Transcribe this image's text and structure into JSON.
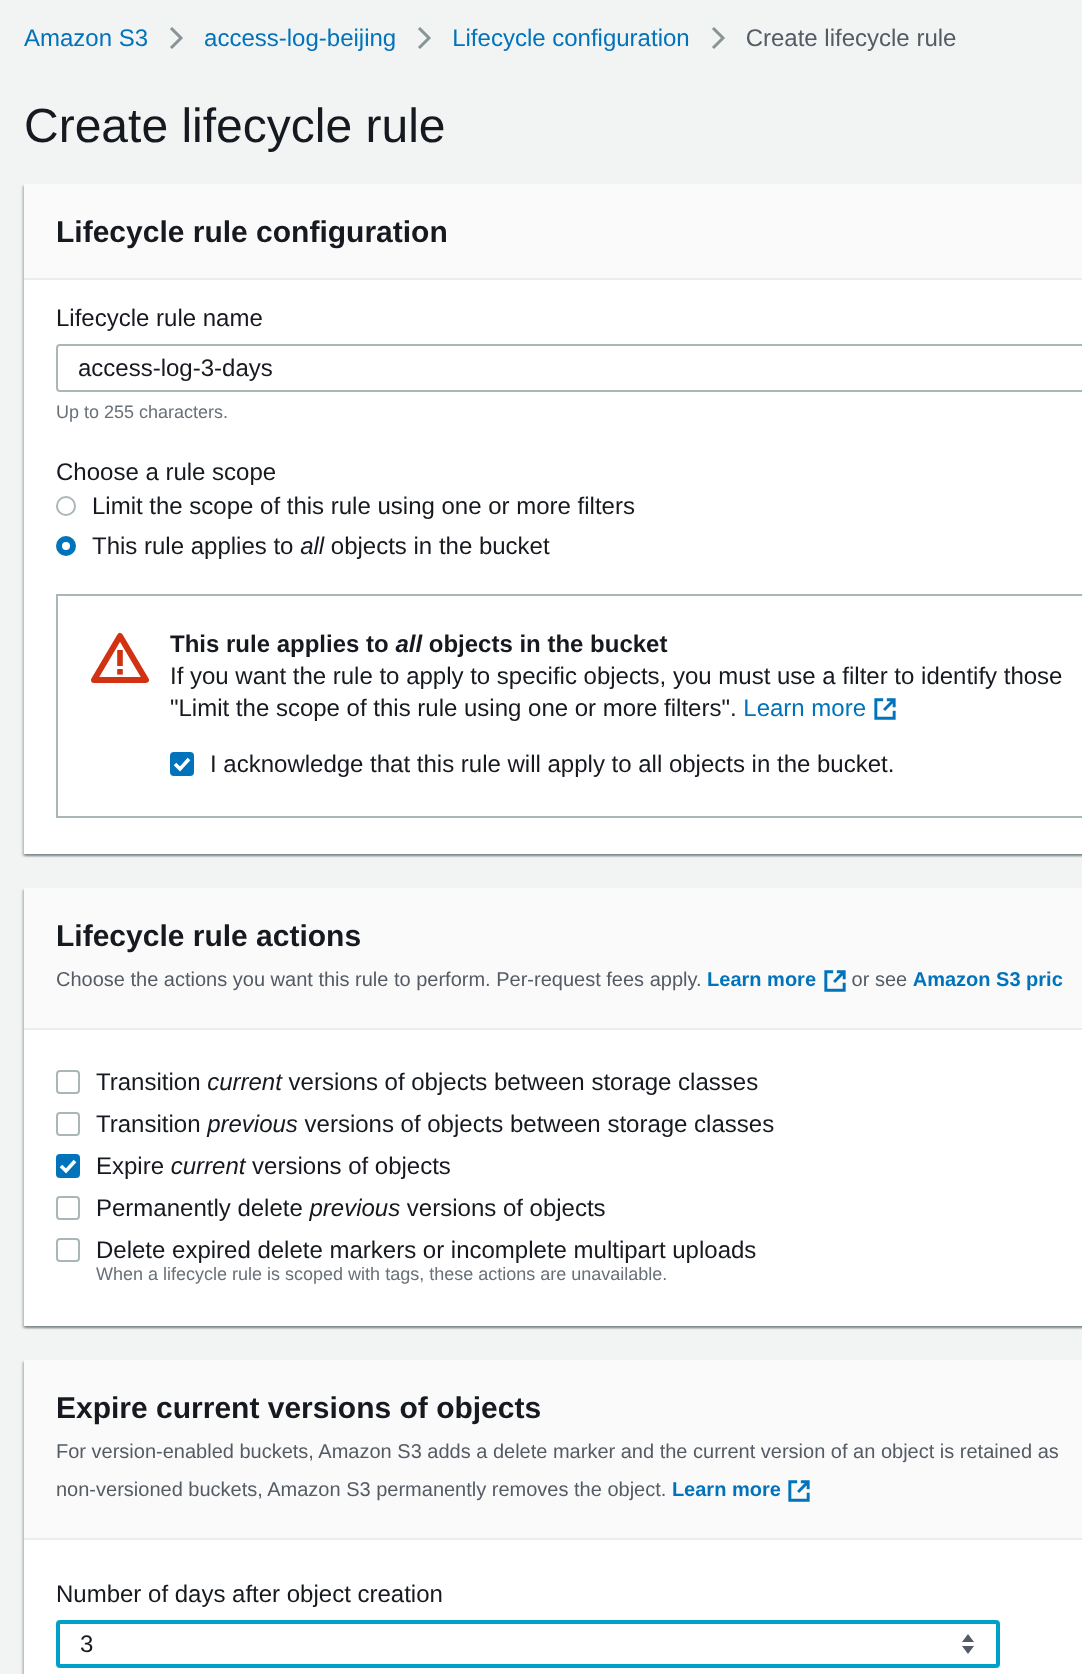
{
  "breadcrumb": [
    {
      "label": "Amazon S3",
      "current": false
    },
    {
      "label": "access-log-beijing",
      "current": false
    },
    {
      "label": "Lifecycle configuration",
      "current": false
    },
    {
      "label": "Create lifecycle rule",
      "current": true
    }
  ],
  "title": "Create lifecycle rule",
  "configuration": {
    "heading": "Lifecycle rule configuration",
    "name_field": {
      "label": "Lifecycle rule name",
      "value": "access-log-3-days",
      "hint": "Up to 255 characters."
    },
    "scope": {
      "label": "Choose a rule scope",
      "options": [
        {
          "label": "Limit the scope of this rule using one or more filters",
          "selected": false
        },
        {
          "label": "This rule applies to *all* objects in the bucket",
          "selected": true
        }
      ]
    },
    "warning": {
      "title": "This rule applies to *all* objects in the bucket",
      "body": [
        {
          "kind": "text",
          "text": "If you want the rule to apply to specific objects, you must use a filter to identify those"
        },
        {
          "kind": "text",
          "text": "\"Limit the scope of this rule using one or more filters\". "
        },
        {
          "kind": "link",
          "text": "Learn more"
        }
      ],
      "acknowledge": {
        "label": "I acknowledge that this rule will apply to all objects in the bucket.",
        "checked": true
      }
    }
  },
  "actions": {
    "heading": "Lifecycle rule actions",
    "description": [
      {
        "kind": "text",
        "text": "Choose the actions you want this rule to perform. Per-request fees apply. "
      },
      {
        "kind": "link",
        "text": "Learn more"
      },
      {
        "kind": "text",
        "text": " or see "
      },
      {
        "kind": "link",
        "text": "Amazon S3 pric",
        "external": false
      }
    ],
    "options": [
      {
        "label": "Transition *current* versions of objects between storage classes",
        "checked": false
      },
      {
        "label": "Transition *previous* versions of objects between storage classes",
        "checked": false
      },
      {
        "label": "Expire *current* versions of objects",
        "checked": true
      },
      {
        "label": "Permanently delete *previous* versions of objects",
        "checked": false
      },
      {
        "label": "Delete expired delete markers or incomplete multipart uploads",
        "checked": false,
        "hint": "When a lifecycle rule is scoped with tags, these actions are unavailable."
      }
    ]
  },
  "expire": {
    "heading": "Expire current versions of objects",
    "description": [
      {
        "kind": "text",
        "text": "For version-enabled buckets, Amazon S3 adds a delete marker and the current version of an object is retained as"
      },
      {
        "kind": "text",
        "text": "non-versioned buckets, Amazon S3 permanently removes the object. "
      },
      {
        "kind": "link",
        "text": "Learn more"
      }
    ],
    "days_field": {
      "label": "Number of days after object creation",
      "value": "3"
    }
  }
}
